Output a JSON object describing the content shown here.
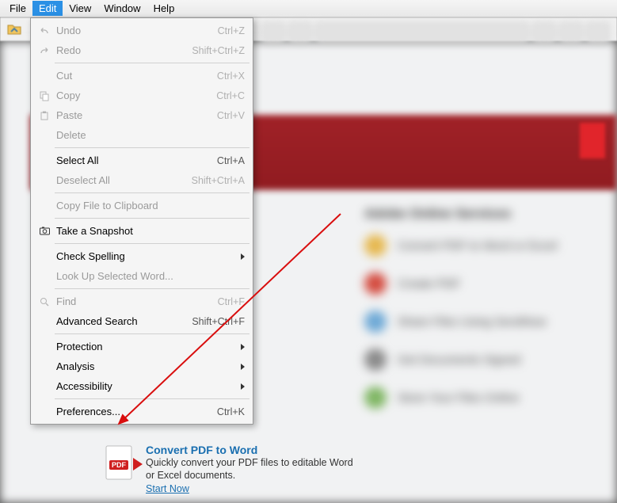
{
  "menubar": {
    "items": [
      "File",
      "Edit",
      "View",
      "Window",
      "Help"
    ],
    "active_index": 1
  },
  "edit_menu": {
    "groups": [
      [
        {
          "icon": "undo-icon",
          "label": "Undo",
          "shortcut": "Ctrl+Z",
          "disabled": true,
          "submenu": false
        },
        {
          "icon": "redo-icon",
          "label": "Redo",
          "shortcut": "Shift+Ctrl+Z",
          "disabled": true,
          "submenu": false
        }
      ],
      [
        {
          "icon": "",
          "label": "Cut",
          "shortcut": "Ctrl+X",
          "disabled": true,
          "submenu": false
        },
        {
          "icon": "copy-icon",
          "label": "Copy",
          "shortcut": "Ctrl+C",
          "disabled": true,
          "submenu": false
        },
        {
          "icon": "paste-icon",
          "label": "Paste",
          "shortcut": "Ctrl+V",
          "disabled": true,
          "submenu": false
        },
        {
          "icon": "",
          "label": "Delete",
          "shortcut": "",
          "disabled": true,
          "submenu": false
        }
      ],
      [
        {
          "icon": "",
          "label": "Select All",
          "shortcut": "Ctrl+A",
          "disabled": false,
          "submenu": false
        },
        {
          "icon": "",
          "label": "Deselect All",
          "shortcut": "Shift+Ctrl+A",
          "disabled": true,
          "submenu": false
        }
      ],
      [
        {
          "icon": "",
          "label": "Copy File to Clipboard",
          "shortcut": "",
          "disabled": true,
          "submenu": false
        }
      ],
      [
        {
          "icon": "camera-icon",
          "label": "Take a Snapshot",
          "shortcut": "",
          "disabled": false,
          "submenu": false
        }
      ],
      [
        {
          "icon": "",
          "label": "Check Spelling",
          "shortcut": "",
          "disabled": false,
          "submenu": true
        },
        {
          "icon": "",
          "label": "Look Up Selected Word...",
          "shortcut": "",
          "disabled": true,
          "submenu": false
        }
      ],
      [
        {
          "icon": "search-icon",
          "label": "Find",
          "shortcut": "Ctrl+F",
          "disabled": true,
          "submenu": false
        },
        {
          "icon": "",
          "label": "Advanced Search",
          "shortcut": "Shift+Ctrl+F",
          "disabled": false,
          "submenu": false
        }
      ],
      [
        {
          "icon": "",
          "label": "Protection",
          "shortcut": "",
          "disabled": false,
          "submenu": true
        },
        {
          "icon": "",
          "label": "Analysis",
          "shortcut": "",
          "disabled": false,
          "submenu": true
        },
        {
          "icon": "",
          "label": "Accessibility",
          "shortcut": "",
          "disabled": false,
          "submenu": true
        }
      ],
      [
        {
          "icon": "",
          "label": "Preferences...",
          "shortcut": "Ctrl+K",
          "disabled": false,
          "submenu": false
        }
      ]
    ]
  },
  "right_column": {
    "heading": "Adobe Online Services",
    "items": [
      {
        "color": "#e6b84f",
        "text": "Convert PDF to Word or Excel"
      },
      {
        "color": "#d44b3f",
        "text": "Create PDF"
      },
      {
        "color": "#6ea9d6",
        "text": "Share Files Using SendNow"
      },
      {
        "color": "#8a8a8a",
        "text": "Get Documents Signed"
      },
      {
        "color": "#7fb663",
        "text": "Store Your Files Online"
      }
    ]
  },
  "promo": {
    "badge": "PDF",
    "title": "Convert PDF to Word",
    "subtitle": "Quickly convert your PDF files to editable Word or Excel documents.",
    "link": "Start Now"
  }
}
